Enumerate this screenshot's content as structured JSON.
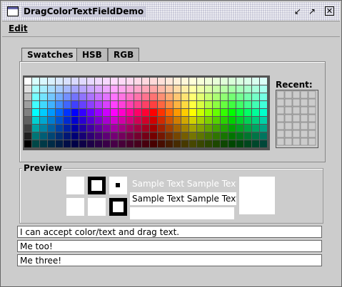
{
  "window": {
    "title": "DragColorTextFieldDemo"
  },
  "menubar": {
    "edit_label": "Edit"
  },
  "tabs": [
    {
      "label": "Swatches"
    },
    {
      "label": "HSB"
    },
    {
      "label": "RGB"
    }
  ],
  "swatches": {
    "recent_label": "Recent:"
  },
  "preview": {
    "label": "Preview",
    "sample_text": "Sample Text"
  },
  "text_fields": [
    {
      "value": "I can accept color/text and drag text."
    },
    {
      "value": "Me too!"
    },
    {
      "value": "Me three!"
    }
  ]
}
